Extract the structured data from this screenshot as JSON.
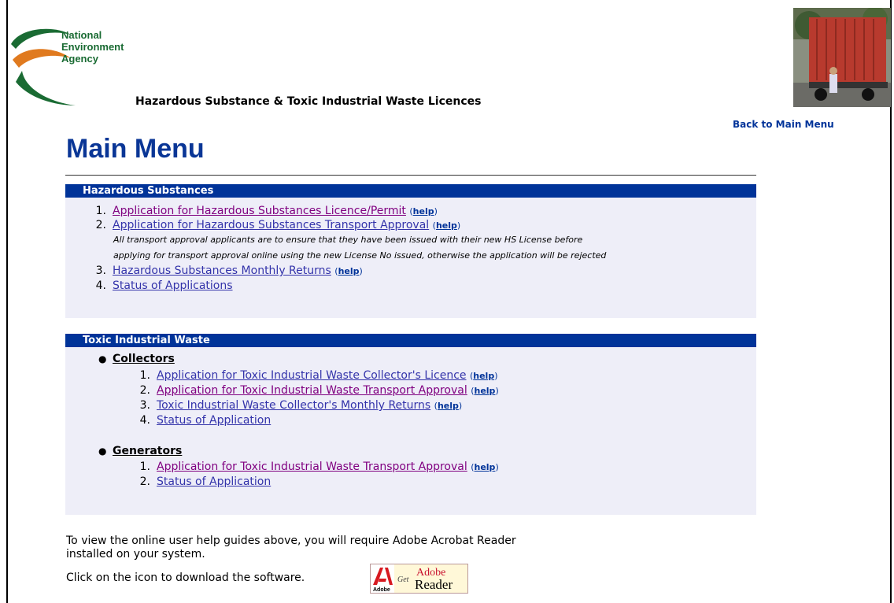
{
  "agency": {
    "line1": "National",
    "line2": "Environment",
    "line3": "Agency"
  },
  "subtitle": "Hazardous Substance & Toxic Industrial Waste Licences",
  "back_link": "Back to Main Menu",
  "page_title": "Main Menu",
  "hs": {
    "header": "Hazardous Substances",
    "items": [
      {
        "num": "1.",
        "label": "Application for Hazardous Substances Licence/Permit",
        "help": "help"
      },
      {
        "num": "2.",
        "label": "Application for Hazardous Substances Transport Approval",
        "help": "help"
      },
      {
        "num": "3.",
        "label": "Hazardous Substances Monthly Returns",
        "help": "help"
      },
      {
        "num": "4.",
        "label": "Status of Applications"
      }
    ],
    "note_line1": "All transport approval applicants are to ensure that they have been issued with their new HS License before",
    "note_line2": "applying for transport approval online using the new License No issued, otherwise the application will be rejected"
  },
  "tiw": {
    "header": "Toxic Industrial Waste",
    "collectors": {
      "title": "Collectors",
      "items": [
        {
          "num": "1.",
          "label": "Application for Toxic Industrial Waste Collector's Licence",
          "help": "help"
        },
        {
          "num": "2.",
          "label": "Application for Toxic Industrial Waste Transport Approval",
          "help": "help"
        },
        {
          "num": "3.",
          "label": "Toxic Industrial Waste Collector's Monthly Returns",
          "help": "help"
        },
        {
          "num": "4.",
          "label": "Status of Application"
        }
      ]
    },
    "generators": {
      "title": "Generators",
      "items": [
        {
          "num": "1.",
          "label": "Application for Toxic Industrial Waste Transport Approval",
          "help": "help"
        },
        {
          "num": "2.",
          "label": "Status of Application"
        }
      ]
    }
  },
  "footer": {
    "line1": "To view the online user help guides above, you will require Adobe Acrobat Reader",
    "line2": "installed on your system.",
    "line3": "Click on the icon to download the software.",
    "adobe_get": "Get",
    "adobe_brand": "Adobe",
    "adobe_reader": "Reader",
    "adobe_small": "Adobe"
  },
  "colors": {
    "nav_blue": "#003399",
    "visited": "#800080",
    "link": "#3333aa",
    "section_bg": "#eeeef8",
    "green": "#1a6b33",
    "orange": "#e07a1f"
  }
}
